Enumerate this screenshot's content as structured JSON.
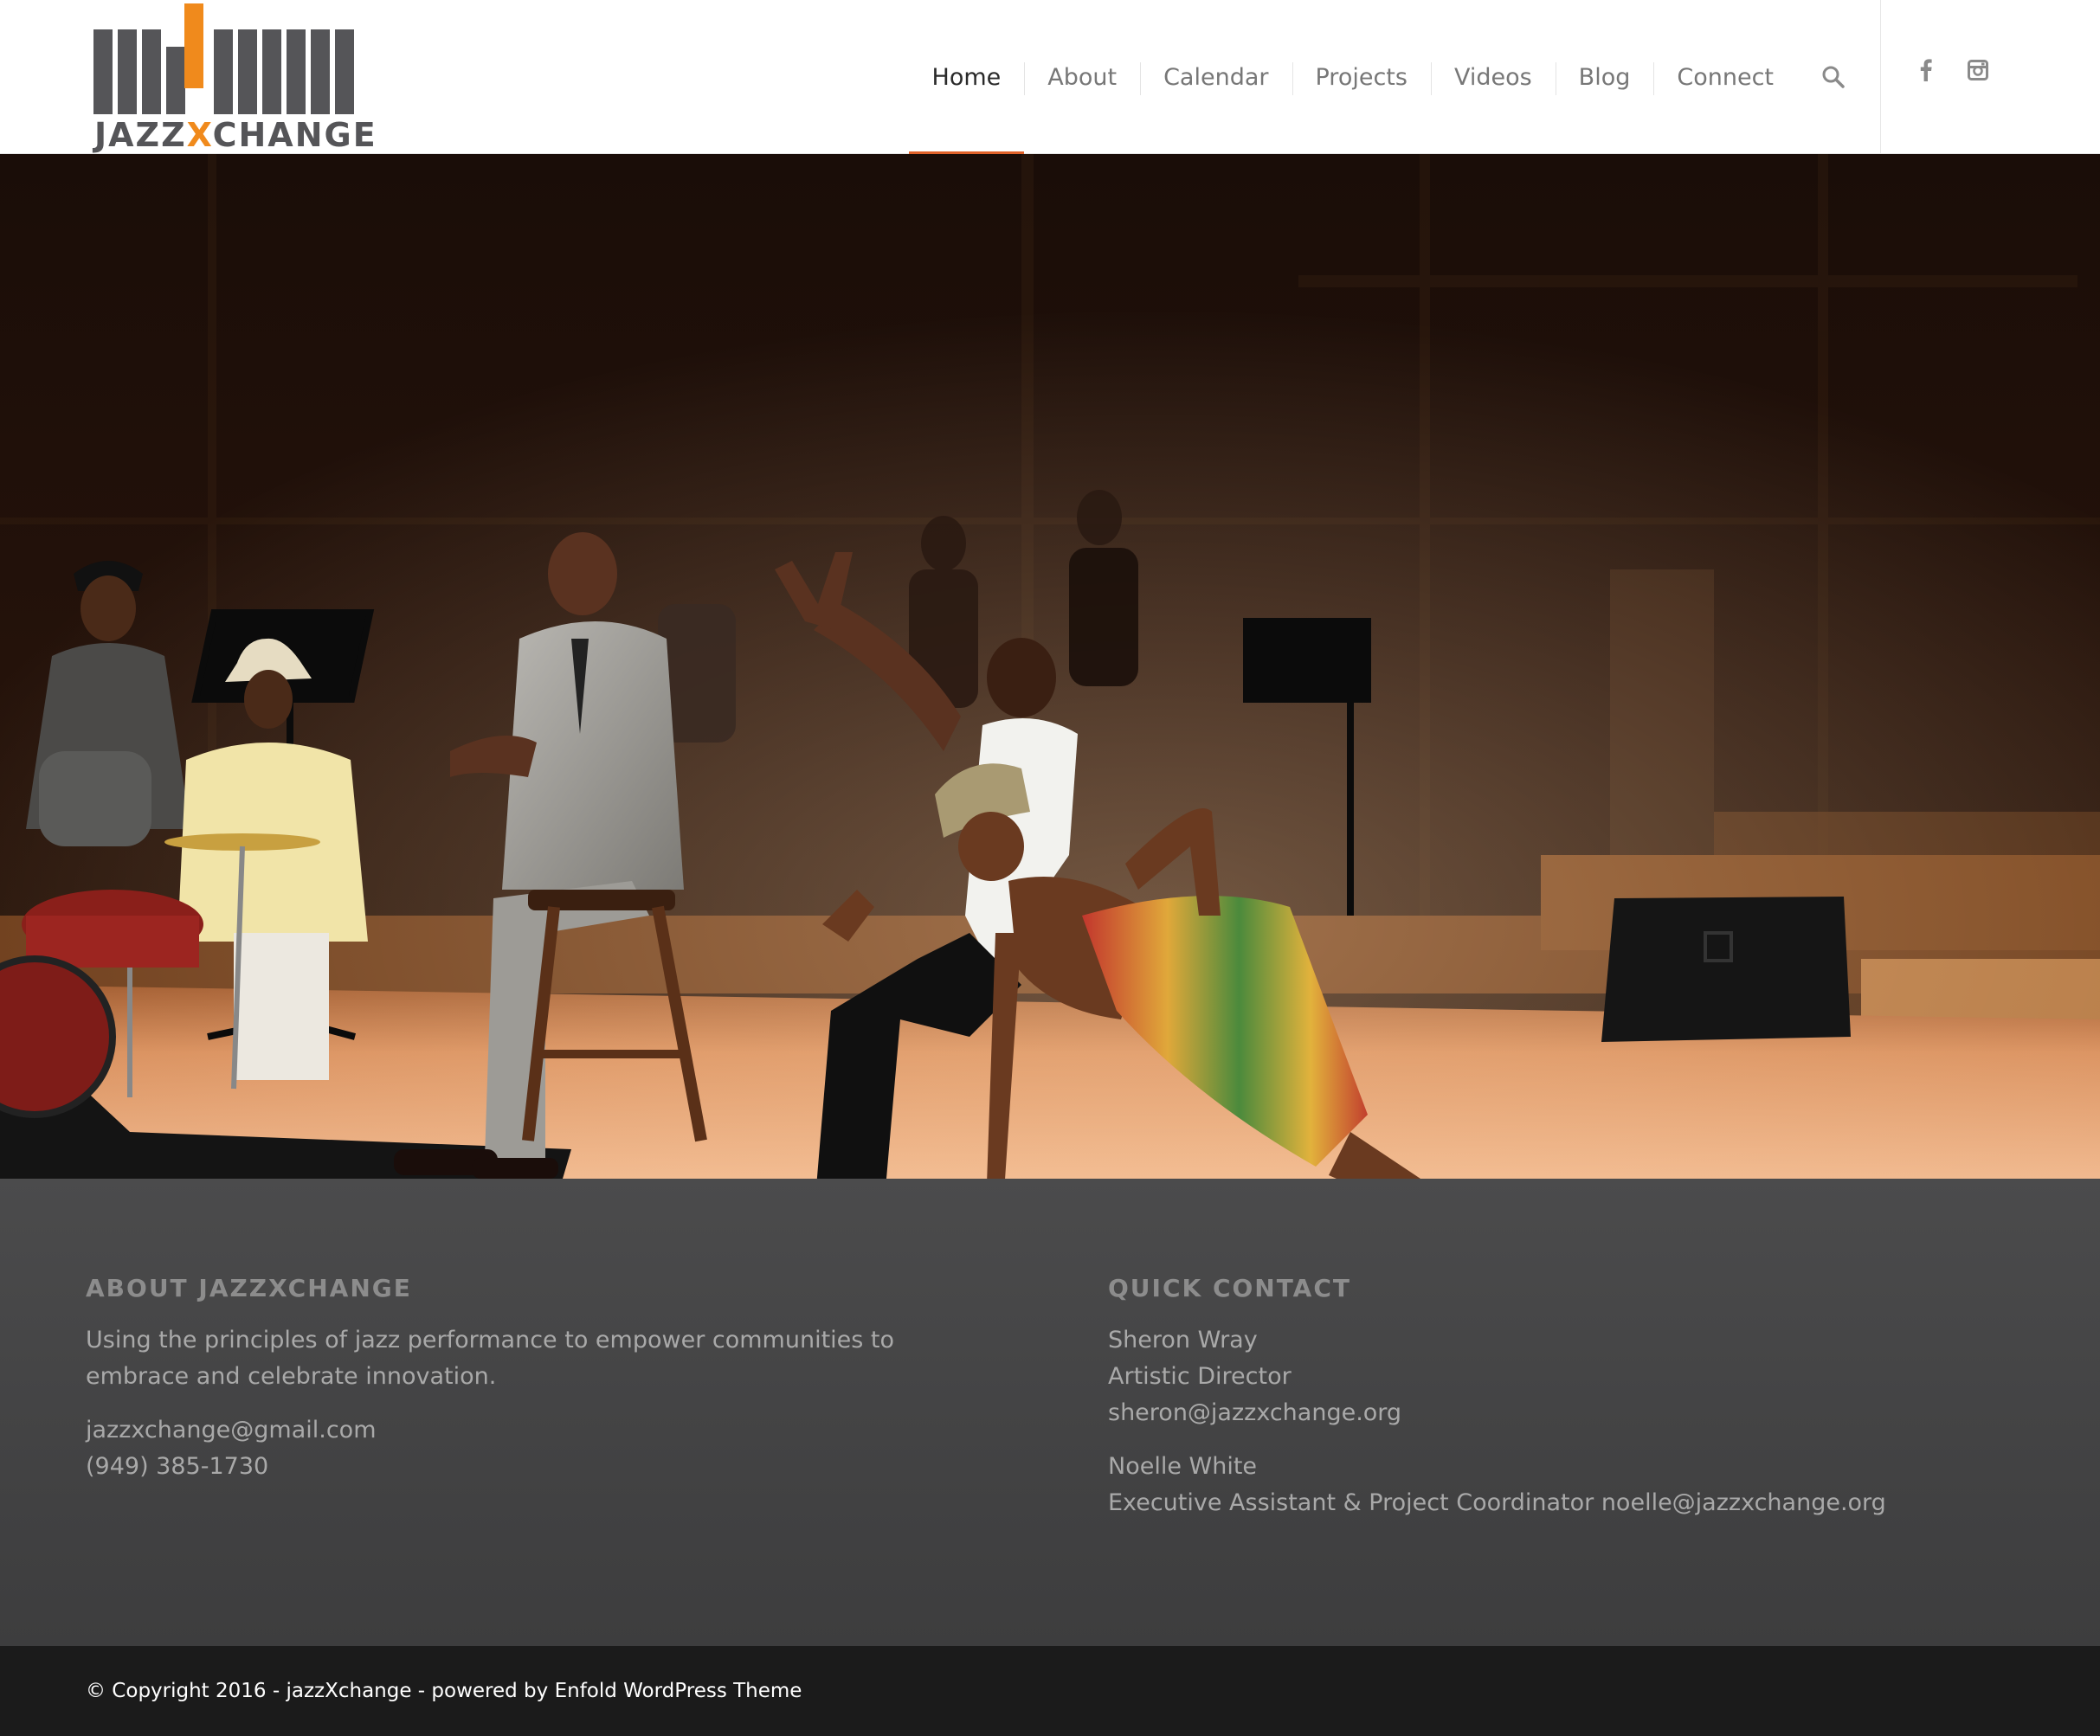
{
  "site": {
    "logo_text_a": "JAZZ",
    "logo_text_x": "X",
    "logo_text_b": "CHANGE"
  },
  "nav": {
    "items": [
      {
        "label": "Home",
        "active": true
      },
      {
        "label": "About",
        "active": false
      },
      {
        "label": "Calendar",
        "active": false
      },
      {
        "label": "Projects",
        "active": false
      },
      {
        "label": "Videos",
        "active": false
      },
      {
        "label": "Blog",
        "active": false
      },
      {
        "label": "Connect",
        "active": false
      }
    ],
    "search_icon": "search-icon",
    "accent_color": "#e0622a"
  },
  "social": {
    "icons": [
      "facebook-icon",
      "instagram-icon"
    ]
  },
  "hero": {
    "image": "stage-performance-dancers-and-band"
  },
  "footer": {
    "about": {
      "heading": "ABOUT JAZZXCHANGE",
      "text": "Using the principles of jazz performance to empower communities to embrace and celebrate innovation.",
      "email": "jazzxchange@gmail.com",
      "phone": "(949) 385-1730"
    },
    "contact": {
      "heading": "QUICK CONTACT",
      "person1_name": "Sheron Wray",
      "person1_title": "Artistic Director",
      "person1_email": "sheron@jazzxchange.org",
      "person2_name": "Noelle White",
      "person2_title_email": "Executive Assistant & Project Coordinator noelle@jazzxchange.org"
    }
  },
  "socket": {
    "copyright": "© Copyright 2016 - jazzXchange - powered by Enfold WordPress Theme"
  }
}
